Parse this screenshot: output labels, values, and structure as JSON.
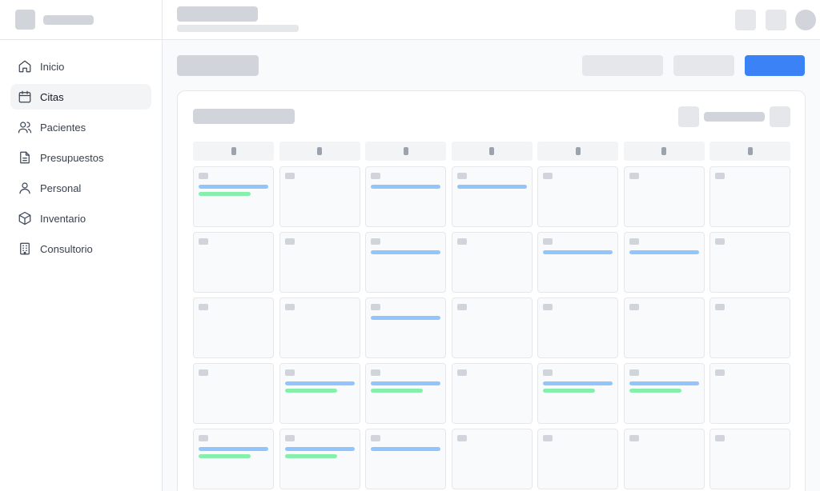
{
  "sidebar": {
    "items": [
      {
        "label": "Inicio",
        "icon": "home-icon",
        "name": "sidebar-item-inicio",
        "active": false
      },
      {
        "label": "Citas",
        "icon": "calendar-icon",
        "name": "sidebar-item-citas",
        "active": true
      },
      {
        "label": "Pacientes",
        "icon": "users-icon",
        "name": "sidebar-item-pacientes",
        "active": false
      },
      {
        "label": "Presupuestos",
        "icon": "document-icon",
        "name": "sidebar-item-presupuestos",
        "active": false
      },
      {
        "label": "Personal",
        "icon": "user-icon",
        "name": "sidebar-item-personal",
        "active": false
      },
      {
        "label": "Inventario",
        "icon": "box-icon",
        "name": "sidebar-item-inventario",
        "active": false
      },
      {
        "label": "Consultorio",
        "icon": "building-icon",
        "name": "sidebar-item-consultorio",
        "active": false
      }
    ]
  },
  "calendar": {
    "weeks": [
      [
        [
          "blue",
          "green"
        ],
        [],
        [
          "blue"
        ],
        [
          "blue"
        ],
        [],
        [],
        []
      ],
      [
        [],
        [],
        [
          "blue"
        ],
        [],
        [
          "blue"
        ],
        [
          "blue"
        ],
        []
      ],
      [
        [],
        [],
        [
          "blue"
        ],
        [],
        [],
        [],
        []
      ],
      [
        [],
        [
          "blue",
          "green"
        ],
        [
          "blue",
          "green"
        ],
        [],
        [
          "blue",
          "green"
        ],
        [
          "blue",
          "green"
        ],
        []
      ],
      [
        [
          "blue",
          "green"
        ],
        [
          "blue",
          "green"
        ],
        [
          "blue"
        ],
        [],
        [],
        [],
        []
      ]
    ]
  },
  "colors": {
    "accent": "#3b82f6",
    "event_blue": "#93c5fd",
    "event_green": "#86efac",
    "skeleton": "#d1d5db"
  }
}
